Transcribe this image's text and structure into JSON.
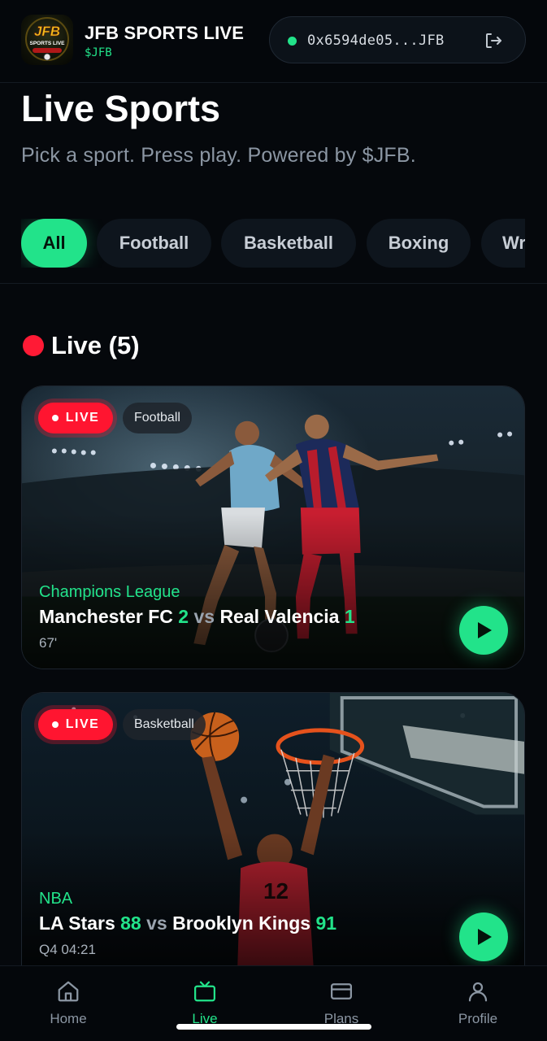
{
  "header": {
    "app_name": "JFB SPORTS LIVE",
    "ticker": "$JFB",
    "logo_text": "JFB SPORTS LIVE",
    "wallet_address": "0x6594de05...JFB",
    "logout_icon": "logout-icon"
  },
  "page": {
    "title": "Live Sports",
    "subtitle": "Pick a sport. Press play. Powered by $JFB."
  },
  "filters": [
    {
      "label": "All",
      "active": true
    },
    {
      "label": "Football",
      "active": false
    },
    {
      "label": "Basketball",
      "active": false
    },
    {
      "label": "Boxing",
      "active": false
    },
    {
      "label": "Wr",
      "active": false
    }
  ],
  "live_section": {
    "heading": "Live (5)"
  },
  "matches": [
    {
      "live_label": "LIVE",
      "sport": "Football",
      "league": "Champions League",
      "home_team": "Manchester FC",
      "home_score": "2",
      "vs": "vs",
      "away_team": "Real Valencia",
      "away_score": "1",
      "time": "67'"
    },
    {
      "live_label": "LIVE",
      "sport": "Basketball",
      "league": "NBA",
      "home_team": "LA Stars",
      "home_score": "88",
      "vs": "vs",
      "away_team": "Brooklyn Kings",
      "away_score": "91",
      "time": "Q4 04:21"
    }
  ],
  "nav": [
    {
      "label": "Home",
      "icon": "home-icon",
      "active": false
    },
    {
      "label": "Live",
      "icon": "tv-icon",
      "active": true
    },
    {
      "label": "Plans",
      "icon": "card-icon",
      "active": false
    },
    {
      "label": "Profile",
      "icon": "user-icon",
      "active": false
    }
  ],
  "colors": {
    "accent": "#22e38a",
    "live_red": "#ff1530",
    "background": "#05080c"
  }
}
